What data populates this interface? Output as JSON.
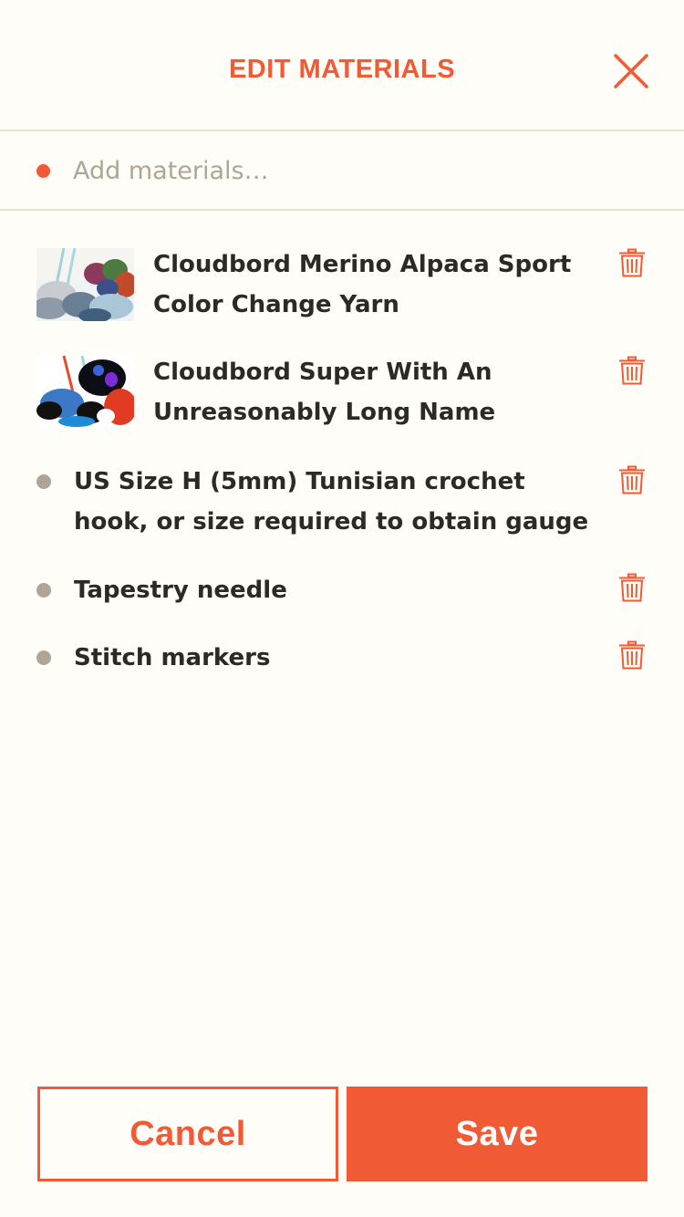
{
  "header": {
    "title": "EDIT MATERIALS",
    "close_icon": "close-icon"
  },
  "add_field": {
    "placeholder": "Add materials…",
    "value": ""
  },
  "materials": [
    {
      "type": "product",
      "title_lines": [
        "Cloudbord Merino Alpaca Sport",
        "Color Change Yarn"
      ],
      "image": "yarn-skeins-thumbnail"
    },
    {
      "type": "product",
      "title_lines": [
        "Cloudbord Super With An",
        "Unreasonably Long Name"
      ],
      "image": "yarn-crochet-thumbnail"
    },
    {
      "type": "text",
      "title_lines": [
        "US Size H (5mm) Tunisian crochet",
        "hook, or size required to obtain gauge"
      ]
    },
    {
      "type": "text",
      "title_lines": [
        "Tapestry needle"
      ]
    },
    {
      "type": "text",
      "title_lines": [
        "Stitch markers"
      ]
    }
  ],
  "footer": {
    "cancel_label": "Cancel",
    "save_label": "Save"
  },
  "colors": {
    "accent": "#f05a35",
    "background": "#fffdf7",
    "divider": "#e9e1d3",
    "bullet": "#aea596",
    "text": "#2d2a26"
  }
}
